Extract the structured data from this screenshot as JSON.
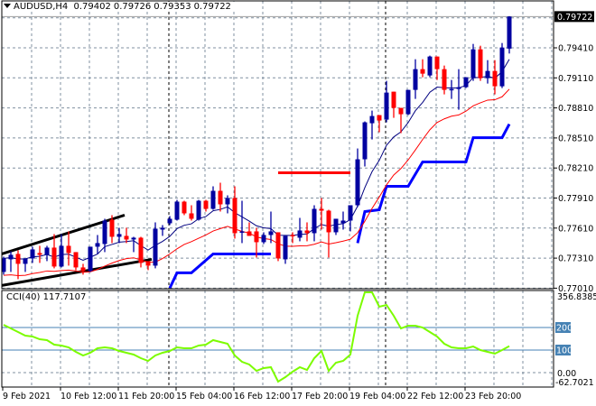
{
  "header": {
    "symbol": "AUDUSD,H4",
    "open": "0.79402",
    "high": "0.79726",
    "low": "0.79353",
    "close": "0.79722"
  },
  "price_axis": {
    "labels": [
      "0.79410",
      "0.79110",
      "0.78810",
      "0.78510",
      "0.78210",
      "0.77910",
      "0.77610",
      "0.77310",
      "0.77010"
    ],
    "current_price": "0.79722"
  },
  "cci_panel": {
    "title": "CCI(40) 117.7107",
    "max_label": "356.8385",
    "level_200": "200",
    "level_100": "100",
    "zero_label": "0.00",
    "min_label": "-62.7021"
  },
  "time_axis": {
    "labels": [
      "9 Feb 2021",
      "10 Feb 12:00",
      "11 Feb 20:00",
      "15 Feb 04:00",
      "16 Feb 12:00",
      "17 Feb 20:00",
      "19 Feb 04:00",
      "22 Feb 12:00",
      "23 Feb 20:00"
    ]
  },
  "colors": {
    "bull": "#0000A0",
    "bear": "#FF0000",
    "ma_fast": "#000080",
    "ma_slow": "#FF0000",
    "stop_line": "#0000FF",
    "cci": "#7CFC00",
    "cci_levels": "#4682B4",
    "grid": "#8090A0"
  },
  "chart_data": {
    "type": "candlestick",
    "price_range": [
      0.7701,
      0.7976
    ],
    "candles_ohlc": [
      [
        0.77172,
        0.77325,
        0.77145,
        0.77307
      ],
      [
        0.77298,
        0.77379,
        0.77172,
        0.77343
      ],
      [
        0.77352,
        0.77388,
        0.771,
        0.77253
      ],
      [
        0.77253,
        0.77307,
        0.77172,
        0.77307
      ],
      [
        0.77307,
        0.77424,
        0.77262,
        0.77397
      ],
      [
        0.77361,
        0.77433,
        0.77262,
        0.77343
      ],
      [
        0.77343,
        0.77433,
        0.7728,
        0.77415
      ],
      [
        0.77415,
        0.7755,
        0.77208,
        0.77226
      ],
      [
        0.77226,
        0.7755,
        0.77217,
        0.77433
      ],
      [
        0.77433,
        0.77577,
        0.77235,
        0.77361
      ],
      [
        0.7737,
        0.7737,
        0.7719,
        0.77217
      ],
      [
        0.77217,
        0.77253,
        0.77145,
        0.77181
      ],
      [
        0.77181,
        0.77424,
        0.77172,
        0.77424
      ],
      [
        0.77424,
        0.77541,
        0.77352,
        0.7746
      ],
      [
        0.77451,
        0.77703,
        0.7737,
        0.77685
      ],
      [
        0.77694,
        0.77739,
        0.7746,
        0.77523
      ],
      [
        0.77523,
        0.77613,
        0.7746,
        0.7755
      ],
      [
        0.77532,
        0.77613,
        0.7746,
        0.77496
      ],
      [
        0.77496,
        0.77523,
        0.7737,
        0.77514
      ],
      [
        0.77514,
        0.77523,
        0.77217,
        0.77262
      ],
      [
        0.7728,
        0.7728,
        0.7719,
        0.77235
      ],
      [
        0.77235,
        0.77667,
        0.77208,
        0.77604
      ],
      [
        0.77595,
        0.7764,
        0.77532,
        0.77613
      ],
      [
        0.77658,
        0.7773,
        0.7764,
        0.77703
      ],
      [
        0.77694,
        0.77892,
        0.77685,
        0.77874
      ],
      [
        0.77874,
        0.77883,
        0.77739,
        0.77757
      ],
      [
        0.77757,
        0.77838,
        0.77685,
        0.77703
      ],
      [
        0.77694,
        0.77892,
        0.77685,
        0.77883
      ],
      [
        0.77883,
        0.77892,
        0.77775,
        0.77802
      ],
      [
        0.77802,
        0.78027,
        0.77793,
        0.77982
      ],
      [
        0.77982,
        0.78063,
        0.77775,
        0.77847
      ],
      [
        0.77847,
        0.77937,
        0.77757,
        0.7791
      ],
      [
        0.7791,
        0.78027,
        0.77505,
        0.77559
      ],
      [
        0.77568,
        0.77883,
        0.7746,
        0.77577
      ],
      [
        0.77577,
        0.77667,
        0.77532,
        0.77532
      ],
      [
        0.77577,
        0.77613,
        0.77316,
        0.77469
      ],
      [
        0.77469,
        0.77568,
        0.77451,
        0.77541
      ],
      [
        0.77541,
        0.77775,
        0.7746,
        0.77577
      ],
      [
        0.77568,
        0.77568,
        0.7728,
        0.77307
      ],
      [
        0.77298,
        0.77532,
        0.77253,
        0.77532
      ],
      [
        0.77541,
        0.77568,
        0.7746,
        0.77532
      ],
      [
        0.77514,
        0.77712,
        0.77478,
        0.77586
      ],
      [
        0.77586,
        0.77667,
        0.77478,
        0.77559
      ],
      [
        0.77559,
        0.77838,
        0.77478,
        0.77802
      ],
      [
        0.77802,
        0.7791,
        0.77595,
        0.77784
      ],
      [
        0.77784,
        0.77793,
        0.77316,
        0.77568
      ],
      [
        0.77568,
        0.77703,
        0.77541,
        0.77703
      ],
      [
        0.77658,
        0.77775,
        0.77595,
        0.77685
      ],
      [
        0.77685,
        0.77838,
        0.77577,
        0.77838
      ],
      [
        0.77838,
        0.78405,
        0.7782,
        0.78297
      ],
      [
        0.78297,
        0.78675,
        0.78225,
        0.78666
      ],
      [
        0.78657,
        0.78783,
        0.78495,
        0.78729
      ],
      [
        0.78738,
        0.78738,
        0.78567,
        0.78684
      ],
      [
        0.78693,
        0.7908,
        0.78666,
        0.78963
      ],
      [
        0.78972,
        0.78972,
        0.78711,
        0.7881
      ],
      [
        0.7881,
        0.7881,
        0.78558,
        0.78747
      ],
      [
        0.78747,
        0.7899,
        0.78738,
        0.7899
      ],
      [
        0.7899,
        0.79296,
        0.789,
        0.79197
      ],
      [
        0.79197,
        0.79296,
        0.79116,
        0.79152
      ],
      [
        0.79134,
        0.79332,
        0.79116,
        0.79323
      ],
      [
        0.79323,
        0.79323,
        0.79089,
        0.79197
      ],
      [
        0.79197,
        0.79233,
        0.78945,
        0.7899
      ],
      [
        0.7899,
        0.79089,
        0.789,
        0.78999
      ],
      [
        0.78999,
        0.79197,
        0.78792,
        0.79017
      ],
      [
        0.79017,
        0.79116,
        0.79008,
        0.79116
      ],
      [
        0.79107,
        0.79449,
        0.7908,
        0.79395
      ],
      [
        0.79395,
        0.79431,
        0.7908,
        0.79107
      ],
      [
        0.79107,
        0.79287,
        0.79053,
        0.79179
      ],
      [
        0.79179,
        0.79287,
        0.78945,
        0.79026
      ],
      [
        0.79026,
        0.79458,
        0.79008,
        0.79413
      ],
      [
        0.79402,
        0.79726,
        0.79353,
        0.79722
      ]
    ],
    "trailing_stop_segments": [
      [
        [
          23,
          0.7701
        ],
        [
          24,
          0.77163
        ],
        [
          26,
          0.77163
        ],
        [
          29,
          0.77352
        ],
        [
          37,
          0.77352
        ]
      ],
      [
        [
          49,
          0.7746
        ],
        [
          50,
          0.77775
        ],
        [
          52,
          0.77793
        ],
        [
          53,
          0.78027
        ],
        [
          56,
          0.78027
        ],
        [
          58,
          0.7827
        ],
        [
          64,
          0.7827
        ],
        [
          65,
          0.78513
        ],
        [
          69,
          0.78513
        ],
        [
          70,
          0.78648
        ]
      ]
    ],
    "horizontal_line": {
      "from": 38,
      "to": 48,
      "price": 0.78162
    },
    "trendlines": [
      [
        [
          -0.25,
          0.77352
        ],
        [
          16.75,
          0.77739
        ]
      ],
      [
        [
          -0.25,
          0.77037
        ],
        [
          20.5,
          0.77298
        ]
      ]
    ],
    "cci": {
      "period": 40,
      "range": [
        -62.7021,
        356.8385
      ],
      "levels": [
        200,
        100,
        0
      ],
      "values": [
        212,
        196,
        180,
        164,
        160,
        148,
        144,
        124,
        120,
        112,
        92,
        76,
        88,
        108,
        112,
        108,
        96,
        88,
        80,
        64,
        52,
        76,
        88,
        96,
        112,
        108,
        108,
        120,
        124,
        144,
        136,
        128,
        76,
        48,
        36,
        8,
        20,
        24,
        -40,
        -20,
        4,
        24,
        12,
        64,
        96,
        8,
        44,
        52,
        80,
        252,
        356,
        356,
        292,
        300,
        252,
        196,
        208,
        208,
        200,
        180,
        160,
        128,
        112,
        108,
        108,
        116,
        100,
        92,
        84,
        100,
        117.7107
      ]
    }
  }
}
